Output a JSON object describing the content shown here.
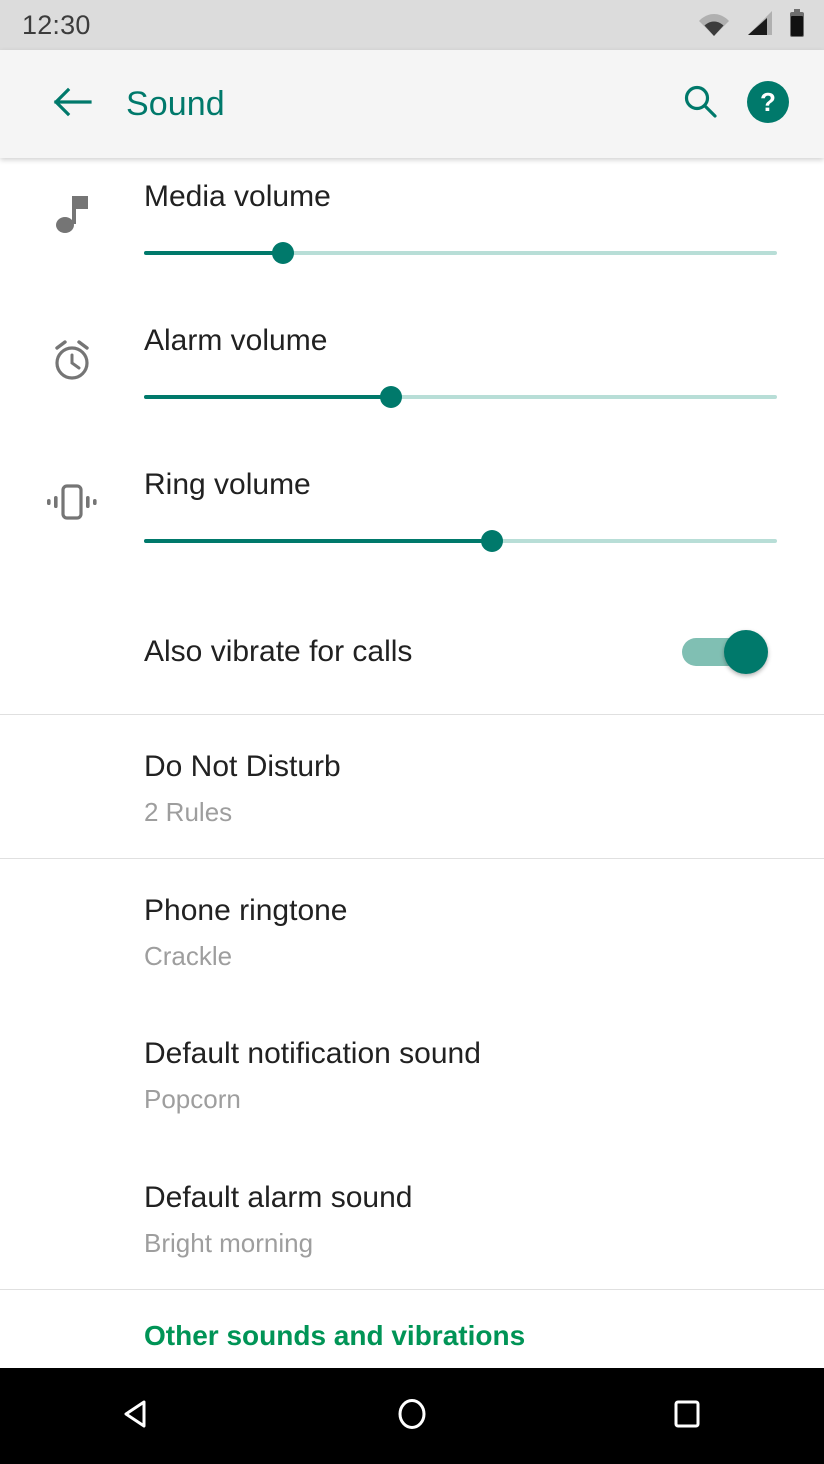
{
  "status_bar": {
    "time": "12:30",
    "icons": [
      "wifi-icon",
      "signal-icon",
      "battery-icon"
    ]
  },
  "app_bar": {
    "back_icon": "back-arrow-icon",
    "title": "Sound",
    "search_icon": "search-icon",
    "help_icon": "help-icon",
    "accent_color": "#00796b",
    "background": "#f5f5f5"
  },
  "volume_sliders": [
    {
      "icon": "music-note-icon",
      "label": "Media volume",
      "percent": 22
    },
    {
      "icon": "alarm-clock-icon",
      "label": "Alarm volume",
      "percent": 39
    },
    {
      "icon": "vibrate-icon",
      "label": "Ring volume",
      "percent": 55
    }
  ],
  "vibrate_switch": {
    "label": "Also vibrate for calls",
    "state": "on",
    "track_color": "#80bfb3",
    "thumb_color": "#00796b"
  },
  "settings_items": [
    {
      "title": "Do Not Disturb",
      "subtitle": "2 Rules"
    },
    {
      "title": "Phone ringtone",
      "subtitle": "Crackle"
    },
    {
      "title": "Default notification sound",
      "subtitle": "Popcorn"
    },
    {
      "title": "Default alarm sound",
      "subtitle": "Bright morning"
    }
  ],
  "other_link": {
    "label": "Other sounds and vibrations",
    "color": "#009456"
  },
  "nav_bar": {
    "back_icon": "nav-back-triangle-icon",
    "home_icon": "nav-home-circle-icon",
    "recents_icon": "nav-recents-square-icon",
    "background": "#000000"
  }
}
